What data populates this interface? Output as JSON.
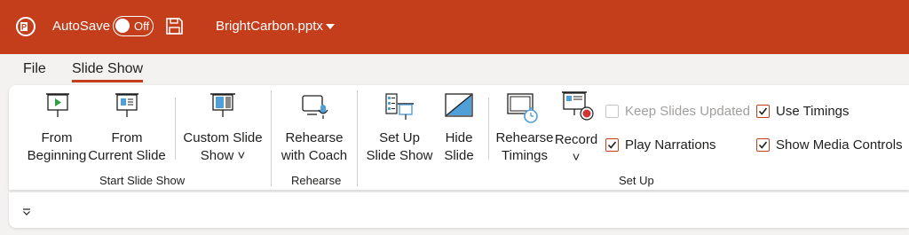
{
  "titlebar": {
    "autosave_label": "AutoSave",
    "autosave_state": "Off",
    "filename": "BrightCarbon.pptx",
    "color": "#c43e1c",
    "icons": [
      "powerpoint-logo",
      "save-icon",
      "chevron-down-icon"
    ]
  },
  "menu": {
    "tabs": [
      {
        "label": "File",
        "active": false
      },
      {
        "label": "Slide Show",
        "active": true
      }
    ]
  },
  "ribbon": {
    "groups": {
      "start": {
        "label": "Start Slide Show",
        "buttons": [
          {
            "label": "From\nBeginning",
            "icon": "play-screen-icon"
          },
          {
            "label": "From\nCurrent Slide",
            "icon": "current-slide-screen-icon"
          },
          {
            "label": "Custom Slide\nShow ˅",
            "icon": "custom-show-icon"
          }
        ]
      },
      "rehearse": {
        "label": "Rehearse",
        "buttons": [
          {
            "label": "Rehearse\nwith Coach",
            "icon": "rehearse-coach-icon"
          }
        ]
      },
      "setup": {
        "label": "Set Up",
        "buttons": [
          {
            "label": "Set Up\nSlide Show",
            "icon": "setup-show-icon"
          },
          {
            "label": "Hide\nSlide",
            "icon": "hide-slide-icon"
          },
          {
            "label": "Rehearse\nTimings",
            "icon": "timer-icon"
          },
          {
            "label": "Record\n˅",
            "icon": "record-icon"
          }
        ],
        "checkboxes": [
          {
            "label": "Keep Slides Updated",
            "checked": false,
            "disabled": true
          },
          {
            "label": "Play Narrations",
            "checked": true,
            "disabled": false
          },
          {
            "label": "Use Timings",
            "checked": true,
            "disabled": false
          },
          {
            "label": "Show Media Controls",
            "checked": true,
            "disabled": false
          }
        ]
      }
    }
  },
  "colors": {
    "accent": "#c43e1c",
    "icon_blue": "#4f9fd8",
    "play_green": "#2ea043"
  }
}
